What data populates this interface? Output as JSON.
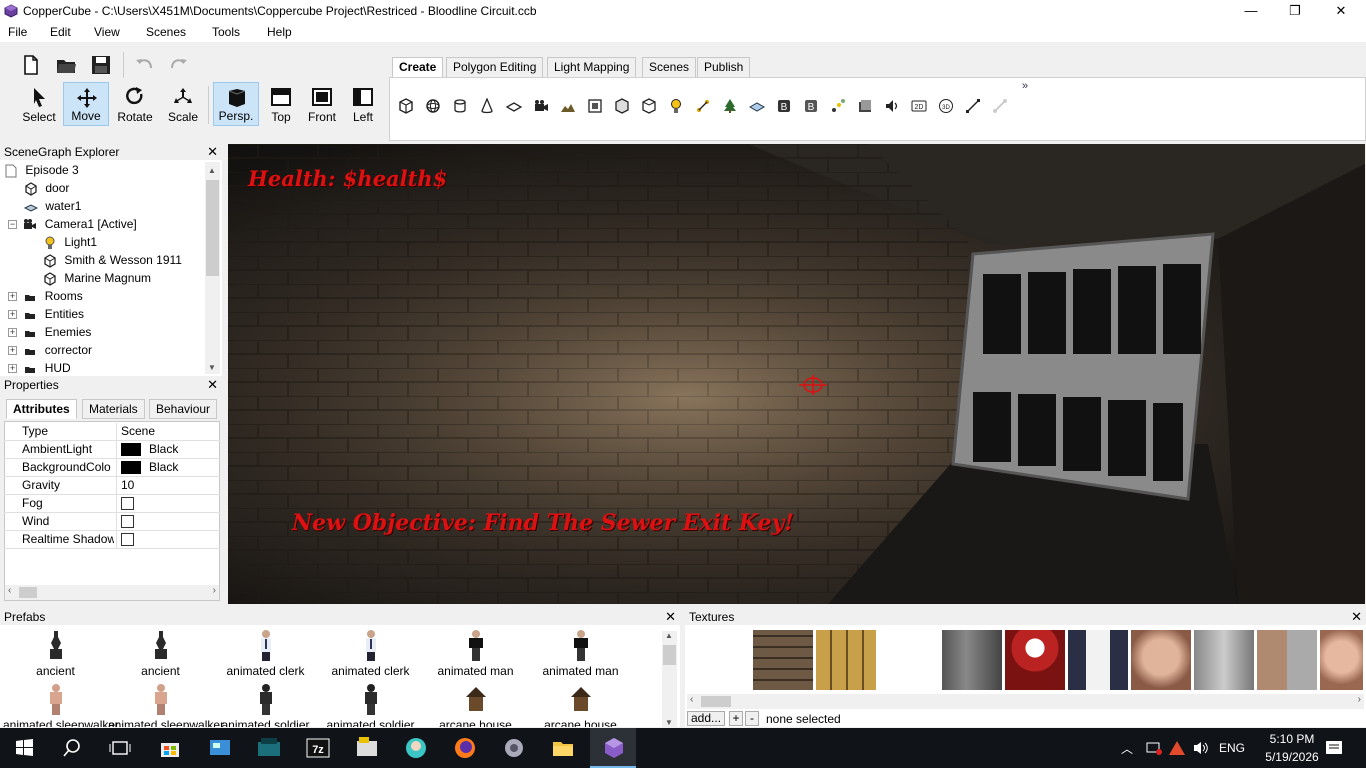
{
  "window": {
    "title": "CopperCube - C:\\Users\\X451M\\Documents\\Coppercube Project\\Restriced - Bloodline Circuit.ccb",
    "minimize": "—",
    "maximize": "❐",
    "close": "✕"
  },
  "menu": [
    "File",
    "Edit",
    "View",
    "Scenes",
    "Tools",
    "Help"
  ],
  "toolbar": {
    "tools": [
      {
        "label": "Select",
        "icon": "arrow-cursor-icon",
        "active": false
      },
      {
        "label": "Move",
        "icon": "move-arrows-icon",
        "active": true
      },
      {
        "label": "Rotate",
        "icon": "rotate-icon",
        "active": false
      },
      {
        "label": "Scale",
        "icon": "scale-icon",
        "active": false
      },
      {
        "label": "Persp.",
        "icon": "perspective-icon",
        "active": true
      },
      {
        "label": "Top",
        "icon": "top-view-icon",
        "active": false
      },
      {
        "label": "Front",
        "icon": "front-view-icon",
        "active": false
      },
      {
        "label": "Left",
        "icon": "left-view-icon",
        "active": false
      }
    ],
    "tabs": [
      "Create",
      "Polygon Editing",
      "Light Mapping",
      "Scenes",
      "Publish"
    ],
    "selected_tab": "Create",
    "more": "»"
  },
  "scenegraph": {
    "title": "SceneGraph Explorer",
    "close": "✕",
    "nodes": [
      {
        "label": "Episode 3",
        "icon": "page-icon"
      },
      {
        "label": "door",
        "icon": "cube-icon"
      },
      {
        "label": "water1",
        "icon": "water-plane-icon"
      },
      {
        "label": "Camera1 [Active]",
        "icon": "camera-icon"
      },
      {
        "label": "Light1",
        "icon": "lightbulb-icon"
      },
      {
        "label": "Smith & Wesson 1911",
        "icon": "cube-icon"
      },
      {
        "label": "Marine Magnum",
        "icon": "cube-icon"
      },
      {
        "label": "Rooms",
        "icon": "folder-icon"
      },
      {
        "label": "Entities",
        "icon": "folder-icon"
      },
      {
        "label": "Enemies",
        "icon": "folder-icon"
      },
      {
        "label": "corrector",
        "icon": "folder-icon"
      },
      {
        "label": "HUD",
        "icon": "folder-icon"
      }
    ]
  },
  "properties": {
    "title": "Properties",
    "close": "✕",
    "tabs": [
      "Attributes",
      "Materials",
      "Behaviour"
    ],
    "rows": [
      {
        "key": "Type",
        "value": "Scene"
      },
      {
        "key": "AmbientLight",
        "value": "Black",
        "swatch": "#000000"
      },
      {
        "key": "BackgroundColo",
        "value": "Black",
        "swatch": "#000000"
      },
      {
        "key": "Gravity",
        "value": "10"
      },
      {
        "key": "Fog",
        "checkbox": false
      },
      {
        "key": "Wind",
        "checkbox": false
      },
      {
        "key": "Realtime Shadow",
        "checkbox": false
      }
    ]
  },
  "viewport": {
    "health_text": "Health: $health$",
    "objective_text": "New Objective: Find The Sewer Exit Key!",
    "hud_color": "#d11111"
  },
  "prefabs": {
    "title": "Prefabs",
    "close": "✕",
    "items": [
      "ancient",
      "ancient",
      "animated clerk",
      "animated clerk",
      "animated man",
      "animated man",
      "animated sleepwalker",
      "animated sleepwalker",
      "animated soldier",
      "animated soldier",
      "arcane house",
      "arcane house"
    ]
  },
  "textures": {
    "title": "Textures",
    "close": "✕",
    "add_label": "add...",
    "plus_label": "+",
    "minus_label": "-",
    "status": "none selected"
  },
  "taskbar": {
    "language": "ENG",
    "time": "5:10 PM",
    "date": "5/19/2026"
  }
}
